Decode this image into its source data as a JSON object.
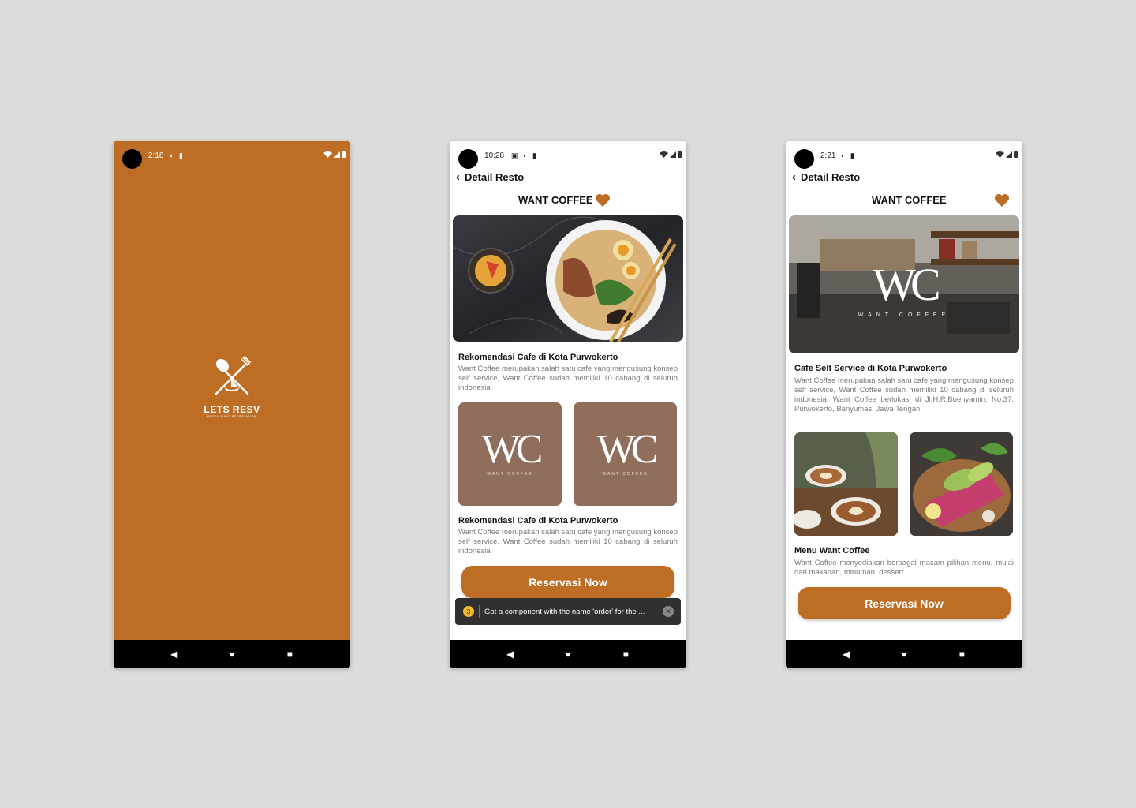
{
  "colors": {
    "brand": "#bd6d24",
    "background": "#dcdcdc",
    "tile_brown": "#8f6e5c"
  },
  "splash": {
    "status_time": "2:18",
    "brand_name": "LETS RESV",
    "tagline": "RESTAURANT RESERVATION"
  },
  "detail_a": {
    "status_time": "10:28",
    "back_label": "Detail Resto",
    "resto_name": "WANT COFFEE",
    "section1_title": "Rekomendasi Cafe di Kota Purwokerto",
    "section1_desc": "Want Coffee merupakan salah satu cafe yang mengusung konsep self service, Want Coffee sudah memiliki 10 cabang di seluruh indonesia",
    "tile_logo": "WC",
    "tile_caption": "WANT COFFEE",
    "section2_title": "Rekomendasi Cafe di Kota Purwokerto",
    "section2_desc": "Want Coffee merupakan salah satu cafe yang mengusung konsep self service, Want Coffee sudah memiliki 10 cabang di seluruh indonesia",
    "cta_label": "Reservasi Now",
    "toast_count": "3",
    "toast_text": "Got a component with the name 'order' for the ..."
  },
  "detail_b": {
    "status_time": "2:21",
    "back_label": "Detail Resto",
    "resto_name": "WANT COFFEE",
    "hero_logo": "WC",
    "hero_caption": "WANT COFFEE",
    "section1_title": "Cafe Self Service di Kota Purwokerto",
    "section1_desc": "Want Coffee merupakan salah satu cafe yang mengusung konsep self service, Want Coffee sudah memiliki 10 cabang di seluruh indonesia. Want Coffee berlokasi di Jl.H.R.Boenyamin, No.37, Purwokerto, Banyumas, Jawa Tengah",
    "section2_title": "Menu Want Coffee",
    "section2_desc": "Want Coffee menyediakan berbagai macam pilihan menu, mulai dari makanan, minuman, dessert.",
    "cta_label": "Reservasi Now"
  }
}
